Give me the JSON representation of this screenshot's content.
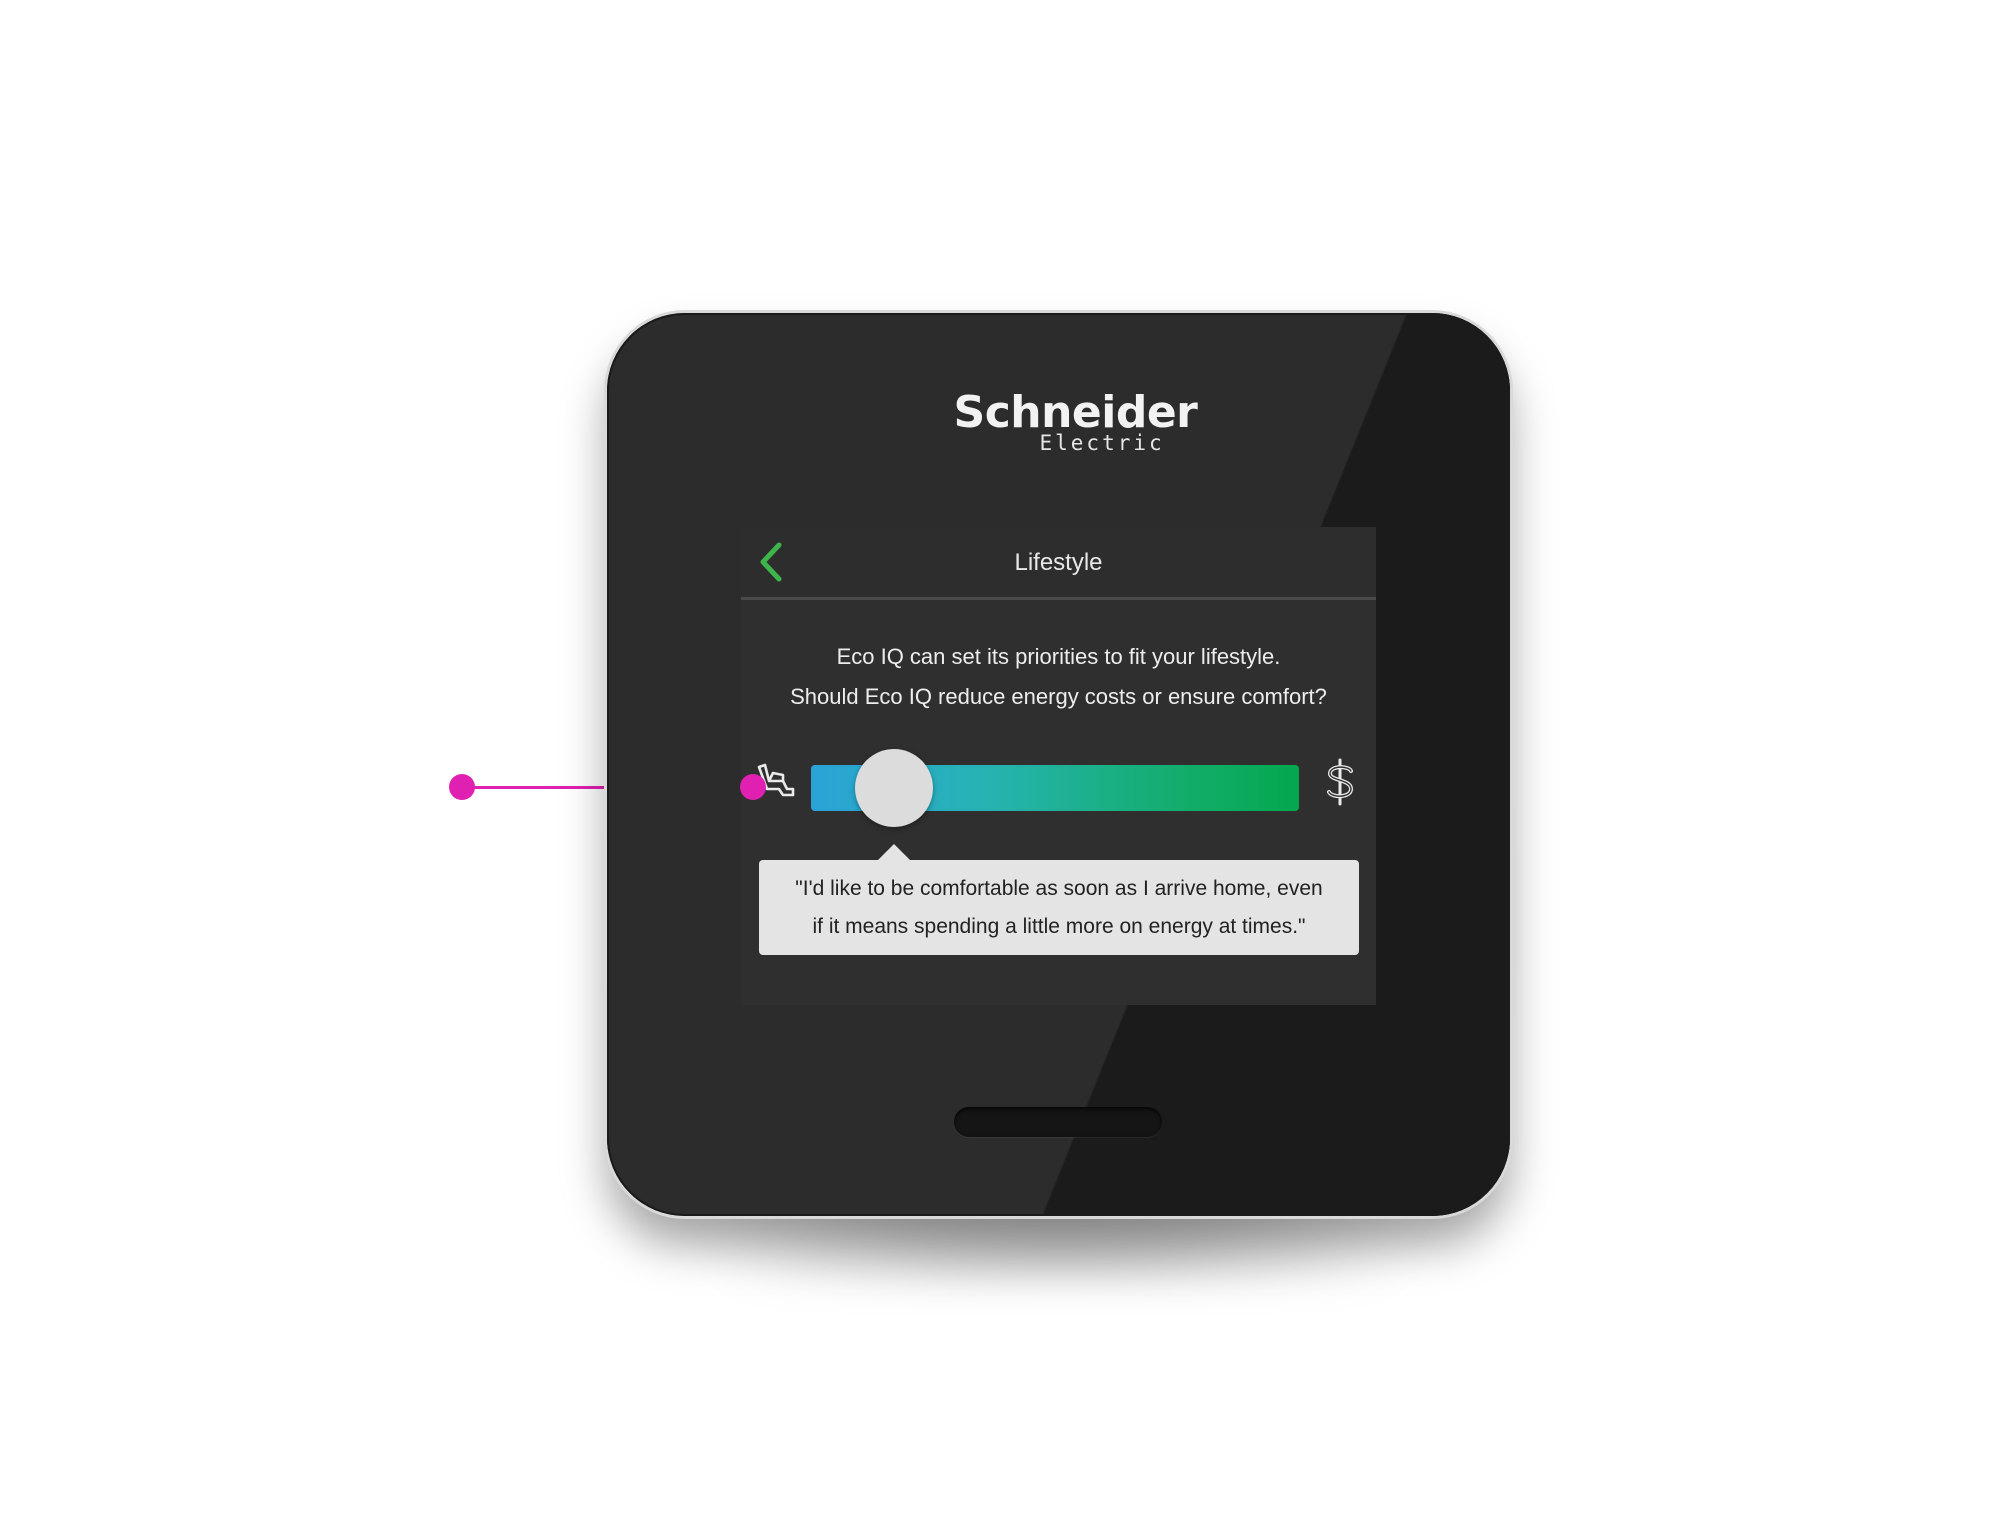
{
  "brand": {
    "name": "Schneider",
    "sub": "Electric"
  },
  "screen": {
    "title": "Lifestyle",
    "intro_line1": "Eco IQ can set its priorities to fit your lifestyle.",
    "intro_line2": "Should Eco IQ reduce energy costs or ensure comfort?",
    "slider": {
      "left_icon": "armchair-comfort-icon",
      "right_icon": "dollar-icon",
      "value_fraction": 0.09
    },
    "tooltip_line1": "\"I'd like to be comfortable as soon as I arrive home, even",
    "tooltip_line2": "if it means spending a little more on energy at times.\""
  },
  "colors": {
    "accent_green": "#3cb54a",
    "slider_start": "#2aa3d8",
    "slider_end": "#03a84e",
    "callout": "#e020b0"
  }
}
